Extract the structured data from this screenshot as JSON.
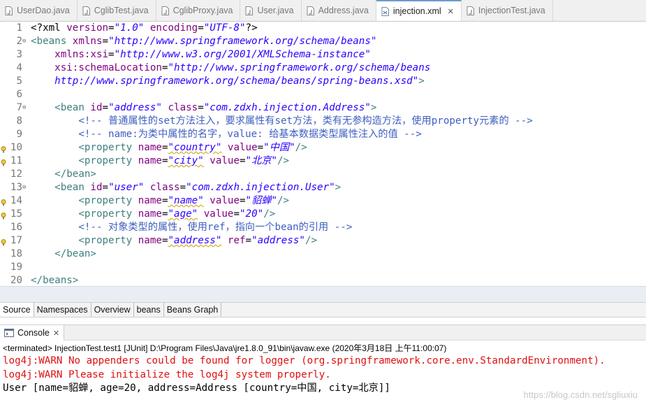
{
  "editor_tabs": [
    {
      "label": "UserDao.java",
      "icon": "java-file-icon",
      "active": false
    },
    {
      "label": "CglibTest.java",
      "icon": "java-file-icon",
      "active": false
    },
    {
      "label": "CglibProxy.java",
      "icon": "java-file-icon",
      "active": false
    },
    {
      "label": "User.java",
      "icon": "java-file-icon",
      "active": false
    },
    {
      "label": "Address.java",
      "icon": "java-file-icon",
      "active": false
    },
    {
      "label": "injection.xml",
      "icon": "xml-file-icon",
      "active": true
    },
    {
      "label": "InjectionTest.java",
      "icon": "java-file-icon",
      "active": false
    }
  ],
  "code_lines": [
    {
      "num": "1",
      "fold": "",
      "marker": false,
      "tokens": [
        [
          "pi",
          "<?xml "
        ],
        [
          "attr",
          "version"
        ],
        [
          "pi",
          "="
        ],
        [
          "val",
          "\"1.0\""
        ],
        [
          "pi",
          " "
        ],
        [
          "attr",
          "encoding"
        ],
        [
          "pi",
          "="
        ],
        [
          "val",
          "\"UTF-8\""
        ],
        [
          "pi",
          "?>"
        ]
      ]
    },
    {
      "num": "2",
      "fold": "⊖",
      "marker": false,
      "tokens": [
        [
          "tag",
          "<beans "
        ],
        [
          "attr",
          "xmlns"
        ],
        [
          "pi",
          "="
        ],
        [
          "val",
          "\"http://www.springframework.org/schema/beans\""
        ]
      ]
    },
    {
      "num": "3",
      "fold": "",
      "marker": false,
      "tokens": [
        [
          "pi",
          "    "
        ],
        [
          "attr",
          "xmlns:xsi"
        ],
        [
          "pi",
          "="
        ],
        [
          "val",
          "\"http://www.w3.org/2001/XMLSchema-instance\""
        ]
      ]
    },
    {
      "num": "4",
      "fold": "",
      "marker": false,
      "tokens": [
        [
          "pi",
          "    "
        ],
        [
          "attr",
          "xsi:schemaLocation"
        ],
        [
          "pi",
          "="
        ],
        [
          "val",
          "\"http://www.springframework.org/schema/beans"
        ]
      ]
    },
    {
      "num": "5",
      "fold": "",
      "marker": false,
      "tokens": [
        [
          "val",
          "    http://www.springframework.org/schema/beans/spring-beans.xsd\""
        ],
        [
          "tag",
          ">"
        ]
      ]
    },
    {
      "num": "6",
      "fold": "",
      "marker": false,
      "tokens": []
    },
    {
      "num": "7",
      "fold": "⊖",
      "marker": false,
      "tokens": [
        [
          "pi",
          "    "
        ],
        [
          "tag",
          "<bean "
        ],
        [
          "attr",
          "id"
        ],
        [
          "pi",
          "="
        ],
        [
          "val",
          "\"address\""
        ],
        [
          "pi",
          " "
        ],
        [
          "attr",
          "class"
        ],
        [
          "pi",
          "="
        ],
        [
          "val",
          "\"com.zdxh.injection.Address\""
        ],
        [
          "tag",
          ">"
        ]
      ]
    },
    {
      "num": "8",
      "fold": "",
      "marker": false,
      "tokens": [
        [
          "cmt",
          "        <!-- 普通属性的set方法注入，要求属性有set方法，类有无参构造方法，使用property元素的 -->"
        ]
      ]
    },
    {
      "num": "9",
      "fold": "",
      "marker": false,
      "tokens": [
        [
          "cmt",
          "        <!-- name:为类中属性的名字，value: 给基本数据类型属性注入的值 -->"
        ]
      ]
    },
    {
      "num": "10",
      "fold": "",
      "marker": true,
      "tokens": [
        [
          "pi",
          "        "
        ],
        [
          "tag",
          "<property "
        ],
        [
          "attr",
          "name"
        ],
        [
          "pi",
          "="
        ],
        [
          "valsq",
          "\"country\""
        ],
        [
          "pi",
          " "
        ],
        [
          "attr",
          "value"
        ],
        [
          "pi",
          "="
        ],
        [
          "val",
          "\"中国\""
        ],
        [
          "tag",
          "/>"
        ]
      ]
    },
    {
      "num": "11",
      "fold": "",
      "marker": true,
      "tokens": [
        [
          "pi",
          "        "
        ],
        [
          "tag",
          "<property "
        ],
        [
          "attr",
          "name"
        ],
        [
          "pi",
          "="
        ],
        [
          "valsq",
          "\"city\""
        ],
        [
          "pi",
          " "
        ],
        [
          "attr",
          "value"
        ],
        [
          "pi",
          "="
        ],
        [
          "val",
          "\"北京\""
        ],
        [
          "tag",
          "/>"
        ]
      ]
    },
    {
      "num": "12",
      "fold": "",
      "marker": false,
      "tokens": [
        [
          "pi",
          "    "
        ],
        [
          "tag",
          "</bean>"
        ]
      ]
    },
    {
      "num": "13",
      "fold": "⊖",
      "marker": false,
      "tokens": [
        [
          "pi",
          "    "
        ],
        [
          "tag",
          "<bean "
        ],
        [
          "attr",
          "id"
        ],
        [
          "pi",
          "="
        ],
        [
          "val",
          "\"user\""
        ],
        [
          "pi",
          " "
        ],
        [
          "attr",
          "class"
        ],
        [
          "pi",
          "="
        ],
        [
          "val",
          "\"com.zdxh.injection.User\""
        ],
        [
          "tag",
          ">"
        ]
      ]
    },
    {
      "num": "14",
      "fold": "",
      "marker": true,
      "tokens": [
        [
          "pi",
          "        "
        ],
        [
          "tag",
          "<property "
        ],
        [
          "attr",
          "name"
        ],
        [
          "pi",
          "="
        ],
        [
          "valsq",
          "\"name\""
        ],
        [
          "pi",
          " "
        ],
        [
          "attr",
          "value"
        ],
        [
          "pi",
          "="
        ],
        [
          "val",
          "\"貂蝉\""
        ],
        [
          "tag",
          "/>"
        ]
      ]
    },
    {
      "num": "15",
      "fold": "",
      "marker": true,
      "tokens": [
        [
          "pi",
          "        "
        ],
        [
          "tag",
          "<property "
        ],
        [
          "attr",
          "name"
        ],
        [
          "pi",
          "="
        ],
        [
          "valsq",
          "\"age\""
        ],
        [
          "pi",
          " "
        ],
        [
          "attr",
          "value"
        ],
        [
          "pi",
          "="
        ],
        [
          "val",
          "\"20\""
        ],
        [
          "tag",
          "/>"
        ]
      ]
    },
    {
      "num": "16",
      "fold": "",
      "marker": false,
      "tokens": [
        [
          "cmt",
          "        <!-- 对象类型的属性，使用ref，指向一个bean的引用 -->"
        ]
      ]
    },
    {
      "num": "17",
      "fold": "",
      "marker": true,
      "tokens": [
        [
          "pi",
          "        "
        ],
        [
          "tag",
          "<property "
        ],
        [
          "attr",
          "name"
        ],
        [
          "pi",
          "="
        ],
        [
          "valsq",
          "\"address\""
        ],
        [
          "pi",
          " "
        ],
        [
          "attr",
          "ref"
        ],
        [
          "pi",
          "="
        ],
        [
          "val",
          "\"address\""
        ],
        [
          "tag",
          "/>"
        ]
      ]
    },
    {
      "num": "18",
      "fold": "",
      "marker": false,
      "tokens": [
        [
          "pi",
          "    "
        ],
        [
          "tag",
          "</bean>"
        ]
      ]
    },
    {
      "num": "19",
      "fold": "",
      "marker": false,
      "tokens": []
    },
    {
      "num": "20",
      "fold": "",
      "marker": false,
      "tokens": [
        [
          "tag",
          "</beans>"
        ]
      ]
    }
  ],
  "bottom_tabs": [
    {
      "label": "Source",
      "active": true
    },
    {
      "label": "Namespaces",
      "active": false
    },
    {
      "label": "Overview",
      "active": false
    },
    {
      "label": "beans",
      "active": false
    },
    {
      "label": "Beans Graph",
      "active": false
    }
  ],
  "console": {
    "tab_label": "Console",
    "status": "<terminated> InjectionTest.test1 [JUnit] D:\\Program Files\\Java\\jre1.8.0_91\\bin\\javaw.exe (2020年3月18日 上午11:00:07)",
    "lines": [
      {
        "kind": "err",
        "text": "log4j:WARN No appenders could be found for logger (org.springframework.core.env.StandardEnvironment)."
      },
      {
        "kind": "err",
        "text": "log4j:WARN Please initialize the log4j system properly."
      },
      {
        "kind": "out",
        "text": "User [name=貂蝉, age=20, address=Address [country=中国, city=北京]]"
      }
    ]
  },
  "watermark": "https://blog.csdn.net/sgliuxiu",
  "colors": {
    "tag": "#3f7f7f",
    "attribute": "#7f007f",
    "value": "#2a00ff",
    "comment": "#3f5fbf",
    "error": "#e01010",
    "active_tab_accent": "#6c9bd2"
  }
}
